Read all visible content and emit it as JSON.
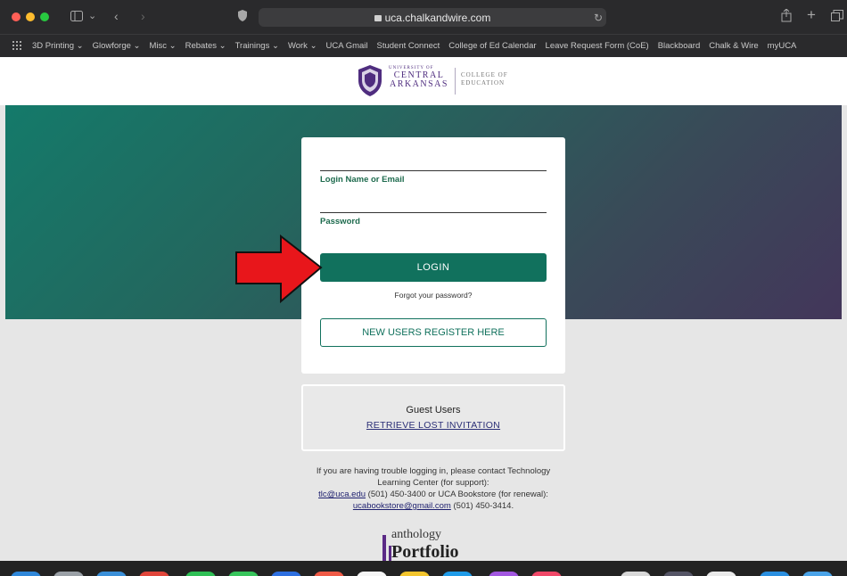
{
  "browser": {
    "url": "uca.chalkandwire.com",
    "bookmarks": [
      "3D Printing ⌄",
      "Glowforge ⌄",
      "Misc ⌄",
      "Rebates ⌄",
      "Trainings ⌄",
      "Work ⌄",
      "UCA Gmail",
      "Student Connect",
      "College of Ed Calendar",
      "Leave Request Form (CoE)",
      "Blackboard",
      "Chalk & Wire",
      "myUCA"
    ]
  },
  "header": {
    "logo_top": "UNIVERSITY OF",
    "logo_main_1": "CENTRAL",
    "logo_main_2": "ARKANSAS",
    "logo_college_1": "COLLEGE OF",
    "logo_college_2": "EDUCATION"
  },
  "login": {
    "username_label": "Login Name or Email",
    "password_label": "Password",
    "login_button": "LOGIN",
    "forgot_link": "Forgot your password?",
    "register_button": "NEW USERS REGISTER HERE"
  },
  "guest": {
    "title": "Guest Users",
    "link": "RETRIEVE LOST INVITATION"
  },
  "help": {
    "line1": "If you are having trouble logging in, please contact Technology Learning Center (for support):",
    "tlc_email": "tlc@uca.edu",
    "tlc_phone": " (501) 450-3400 or UCA Bookstore (for renewal): ",
    "bookstore_email": "ucabookstore@gmail.com",
    "bookstore_phone": " (501) 450-3414."
  },
  "branding": {
    "anthology_top": "anthology",
    "anthology_bottom": "Portfolio"
  },
  "colors": {
    "primary_green": "#11715d",
    "annotation_arrow": "#e8161b"
  }
}
